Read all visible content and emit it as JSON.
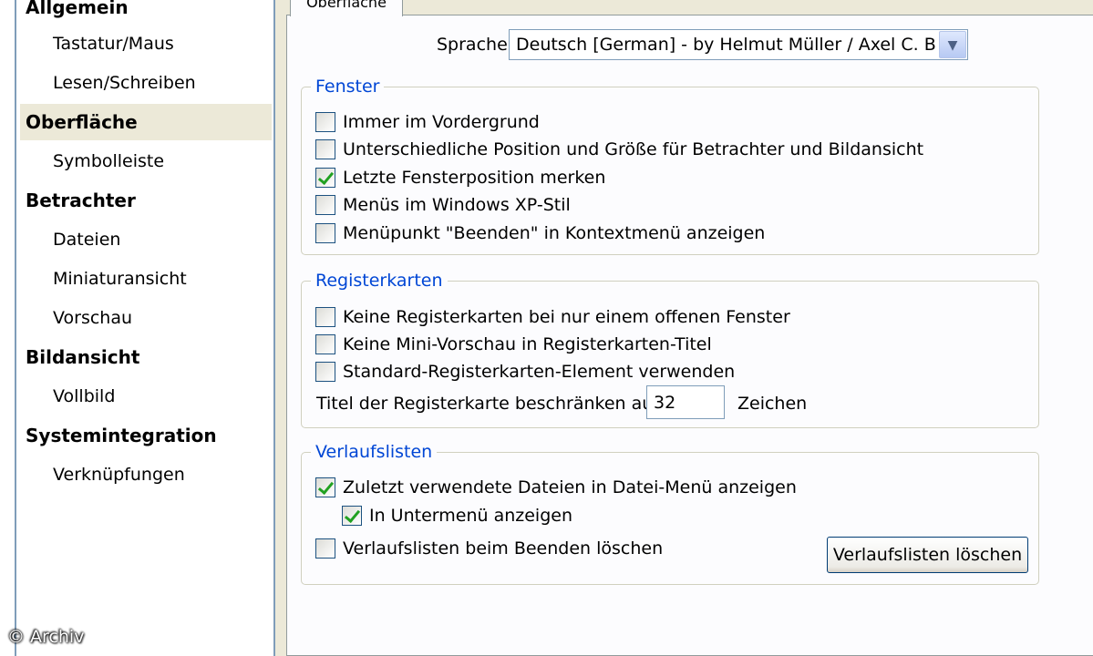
{
  "nav": {
    "items": [
      {
        "label": "Allgemein",
        "level": 0,
        "selected": false
      },
      {
        "label": "Tastatur/Maus",
        "level": 1,
        "selected": false
      },
      {
        "label": "Lesen/Schreiben",
        "level": 1,
        "selected": false
      },
      {
        "label": "Oberfläche",
        "level": 0,
        "selected": true
      },
      {
        "label": "Symbolleiste",
        "level": 1,
        "selected": false
      },
      {
        "label": "Betrachter",
        "level": 0,
        "selected": false
      },
      {
        "label": "Dateien",
        "level": 1,
        "selected": false
      },
      {
        "label": "Miniaturansicht",
        "level": 1,
        "selected": false
      },
      {
        "label": "Vorschau",
        "level": 1,
        "selected": false
      },
      {
        "label": "Bildansicht",
        "level": 0,
        "selected": false
      },
      {
        "label": "Vollbild",
        "level": 1,
        "selected": false
      },
      {
        "label": "Systemintegration",
        "level": 0,
        "selected": false
      },
      {
        "label": "Verknüpfungen",
        "level": 1,
        "selected": false
      }
    ]
  },
  "watermark": "© Archiv",
  "tab": {
    "label": "Oberfläche"
  },
  "language": {
    "label": "Sprache",
    "value": "Deutsch [German] - by Helmut Müller / Axel C. Burgbacher",
    "arrow_icon": "chevron-down-icon"
  },
  "groups": {
    "fenster": {
      "title": "Fenster",
      "options": [
        {
          "label": "Immer im Vordergrund",
          "checked": false
        },
        {
          "label": "Unterschiedliche Position und Größe für Betrachter und Bildansicht",
          "checked": false
        },
        {
          "label": "Letzte Fensterposition merken",
          "checked": true
        },
        {
          "label": "Menüs im Windows XP-Stil",
          "checked": false
        },
        {
          "label": "Menüpunkt \"Beenden\" in Kontextmenü anzeigen",
          "checked": false
        }
      ]
    },
    "register": {
      "title": "Registerkarten",
      "options": [
        {
          "label": "Keine Registerkarten bei nur einem offenen Fenster",
          "checked": false
        },
        {
          "label": "Keine Mini-Vorschau in Registerkarten-Titel",
          "checked": false
        },
        {
          "label": "Standard-Registerkarten-Element verwenden",
          "checked": false
        }
      ],
      "title_length": {
        "label": "Titel der Registerkarte beschränken auf",
        "value": "32",
        "unit": "Zeichen"
      }
    },
    "verlauf": {
      "title": "Verlaufslisten",
      "options": [
        {
          "label": "Zuletzt verwendete Dateien in Datei-Menü anzeigen",
          "checked": true
        },
        {
          "label": "In Untermenü anzeigen",
          "checked": true
        },
        {
          "label": "Verlaufslisten beim Beenden löschen",
          "checked": false
        }
      ],
      "clear_button": "Verlaufslisten löschen"
    }
  }
}
